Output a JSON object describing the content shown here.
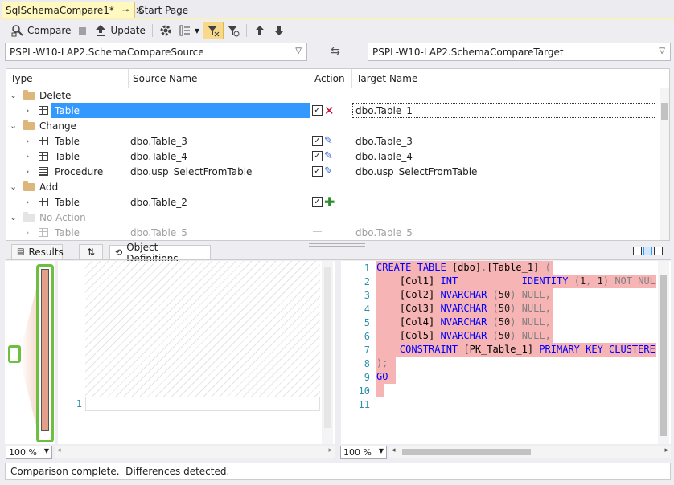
{
  "tabs": [
    {
      "label": "SqlSchemaCompare1*",
      "active": true,
      "pin_icon": "pin-icon",
      "close_icon": "close-icon"
    },
    {
      "label": "Start Page",
      "active": false
    }
  ],
  "toolbar": {
    "compare_label": "Compare",
    "update_label": "Update",
    "icons": [
      "compare-icon",
      "stop-icon",
      "update-icon",
      "settings-icon",
      "group-results-icon",
      "filter-icon",
      "filter-objects-icon",
      "previous-change-icon",
      "next-change-icon"
    ]
  },
  "source": {
    "value": "PSPL-W10-LAP2.SchemaCompareSource"
  },
  "target": {
    "value": "PSPL-W10-LAP2.SchemaCompareTarget"
  },
  "grid": {
    "columns": [
      "Type",
      "Source Name",
      "Action",
      "Target Name"
    ],
    "groups": {
      "delete": "Delete",
      "change": "Change",
      "add": "Add",
      "no_action": "No Action"
    },
    "rows": {
      "delete_table": {
        "type": "Table",
        "source": "",
        "target": "dbo.Table_1"
      },
      "change_table3": {
        "type": "Table",
        "source": "dbo.Table_3",
        "target": "dbo.Table_3"
      },
      "change_table4": {
        "type": "Table",
        "source": "dbo.Table_4",
        "target": "dbo.Table_4"
      },
      "change_proc": {
        "type": "Procedure",
        "source": "dbo.usp_SelectFromTable",
        "target": "dbo.usp_SelectFromTable"
      },
      "add_table2": {
        "type": "Table",
        "source": "dbo.Table_2",
        "target": ""
      },
      "noaction_table5": {
        "type": "Table",
        "source": "dbo.Table_5",
        "target": "dbo.Table_5"
      }
    }
  },
  "bottom_tabs": {
    "results": "Results",
    "object_definitions": "Object Definitions"
  },
  "left_editor": {
    "line_numbers": [
      "1"
    ],
    "zoom": "100 %"
  },
  "right_editor": {
    "zoom": "100 %",
    "line_numbers": [
      "1",
      "2",
      "3",
      "4",
      "5",
      "6",
      "7",
      "8",
      "9",
      "10",
      "11"
    ]
  },
  "status": {
    "text": "Comparison complete.  Differences detected."
  }
}
